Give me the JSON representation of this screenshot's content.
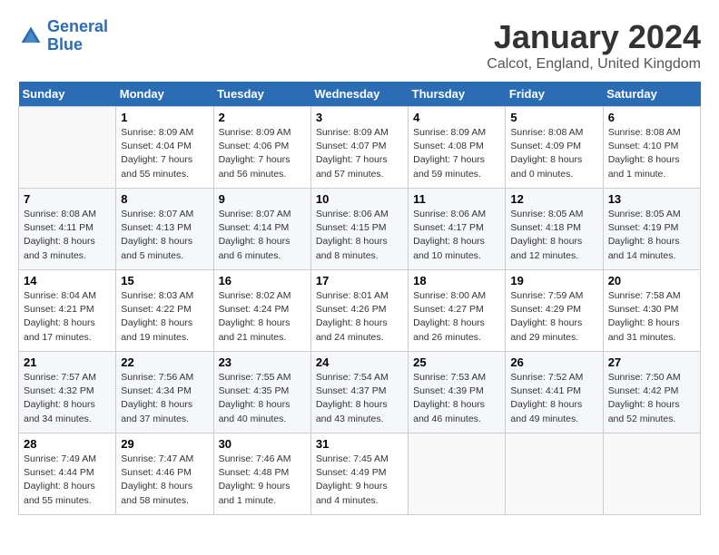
{
  "logo": {
    "line1": "General",
    "line2": "Blue"
  },
  "title": "January 2024",
  "subtitle": "Calcot, England, United Kingdom",
  "days_of_week": [
    "Sunday",
    "Monday",
    "Tuesday",
    "Wednesday",
    "Thursday",
    "Friday",
    "Saturday"
  ],
  "weeks": [
    [
      {
        "day": "",
        "info": ""
      },
      {
        "day": "1",
        "info": "Sunrise: 8:09 AM\nSunset: 4:04 PM\nDaylight: 7 hours\nand 55 minutes."
      },
      {
        "day": "2",
        "info": "Sunrise: 8:09 AM\nSunset: 4:06 PM\nDaylight: 7 hours\nand 56 minutes."
      },
      {
        "day": "3",
        "info": "Sunrise: 8:09 AM\nSunset: 4:07 PM\nDaylight: 7 hours\nand 57 minutes."
      },
      {
        "day": "4",
        "info": "Sunrise: 8:09 AM\nSunset: 4:08 PM\nDaylight: 7 hours\nand 59 minutes."
      },
      {
        "day": "5",
        "info": "Sunrise: 8:08 AM\nSunset: 4:09 PM\nDaylight: 8 hours\nand 0 minutes."
      },
      {
        "day": "6",
        "info": "Sunrise: 8:08 AM\nSunset: 4:10 PM\nDaylight: 8 hours\nand 1 minute."
      }
    ],
    [
      {
        "day": "7",
        "info": "Sunrise: 8:08 AM\nSunset: 4:11 PM\nDaylight: 8 hours\nand 3 minutes."
      },
      {
        "day": "8",
        "info": "Sunrise: 8:07 AM\nSunset: 4:13 PM\nDaylight: 8 hours\nand 5 minutes."
      },
      {
        "day": "9",
        "info": "Sunrise: 8:07 AM\nSunset: 4:14 PM\nDaylight: 8 hours\nand 6 minutes."
      },
      {
        "day": "10",
        "info": "Sunrise: 8:06 AM\nSunset: 4:15 PM\nDaylight: 8 hours\nand 8 minutes."
      },
      {
        "day": "11",
        "info": "Sunrise: 8:06 AM\nSunset: 4:17 PM\nDaylight: 8 hours\nand 10 minutes."
      },
      {
        "day": "12",
        "info": "Sunrise: 8:05 AM\nSunset: 4:18 PM\nDaylight: 8 hours\nand 12 minutes."
      },
      {
        "day": "13",
        "info": "Sunrise: 8:05 AM\nSunset: 4:19 PM\nDaylight: 8 hours\nand 14 minutes."
      }
    ],
    [
      {
        "day": "14",
        "info": "Sunrise: 8:04 AM\nSunset: 4:21 PM\nDaylight: 8 hours\nand 17 minutes."
      },
      {
        "day": "15",
        "info": "Sunrise: 8:03 AM\nSunset: 4:22 PM\nDaylight: 8 hours\nand 19 minutes."
      },
      {
        "day": "16",
        "info": "Sunrise: 8:02 AM\nSunset: 4:24 PM\nDaylight: 8 hours\nand 21 minutes."
      },
      {
        "day": "17",
        "info": "Sunrise: 8:01 AM\nSunset: 4:26 PM\nDaylight: 8 hours\nand 24 minutes."
      },
      {
        "day": "18",
        "info": "Sunrise: 8:00 AM\nSunset: 4:27 PM\nDaylight: 8 hours\nand 26 minutes."
      },
      {
        "day": "19",
        "info": "Sunrise: 7:59 AM\nSunset: 4:29 PM\nDaylight: 8 hours\nand 29 minutes."
      },
      {
        "day": "20",
        "info": "Sunrise: 7:58 AM\nSunset: 4:30 PM\nDaylight: 8 hours\nand 31 minutes."
      }
    ],
    [
      {
        "day": "21",
        "info": "Sunrise: 7:57 AM\nSunset: 4:32 PM\nDaylight: 8 hours\nand 34 minutes."
      },
      {
        "day": "22",
        "info": "Sunrise: 7:56 AM\nSunset: 4:34 PM\nDaylight: 8 hours\nand 37 minutes."
      },
      {
        "day": "23",
        "info": "Sunrise: 7:55 AM\nSunset: 4:35 PM\nDaylight: 8 hours\nand 40 minutes."
      },
      {
        "day": "24",
        "info": "Sunrise: 7:54 AM\nSunset: 4:37 PM\nDaylight: 8 hours\nand 43 minutes."
      },
      {
        "day": "25",
        "info": "Sunrise: 7:53 AM\nSunset: 4:39 PM\nDaylight: 8 hours\nand 46 minutes."
      },
      {
        "day": "26",
        "info": "Sunrise: 7:52 AM\nSunset: 4:41 PM\nDaylight: 8 hours\nand 49 minutes."
      },
      {
        "day": "27",
        "info": "Sunrise: 7:50 AM\nSunset: 4:42 PM\nDaylight: 8 hours\nand 52 minutes."
      }
    ],
    [
      {
        "day": "28",
        "info": "Sunrise: 7:49 AM\nSunset: 4:44 PM\nDaylight: 8 hours\nand 55 minutes."
      },
      {
        "day": "29",
        "info": "Sunrise: 7:47 AM\nSunset: 4:46 PM\nDaylight: 8 hours\nand 58 minutes."
      },
      {
        "day": "30",
        "info": "Sunrise: 7:46 AM\nSunset: 4:48 PM\nDaylight: 9 hours\nand 1 minute."
      },
      {
        "day": "31",
        "info": "Sunrise: 7:45 AM\nSunset: 4:49 PM\nDaylight: 9 hours\nand 4 minutes."
      },
      {
        "day": "",
        "info": ""
      },
      {
        "day": "",
        "info": ""
      },
      {
        "day": "",
        "info": ""
      }
    ]
  ]
}
